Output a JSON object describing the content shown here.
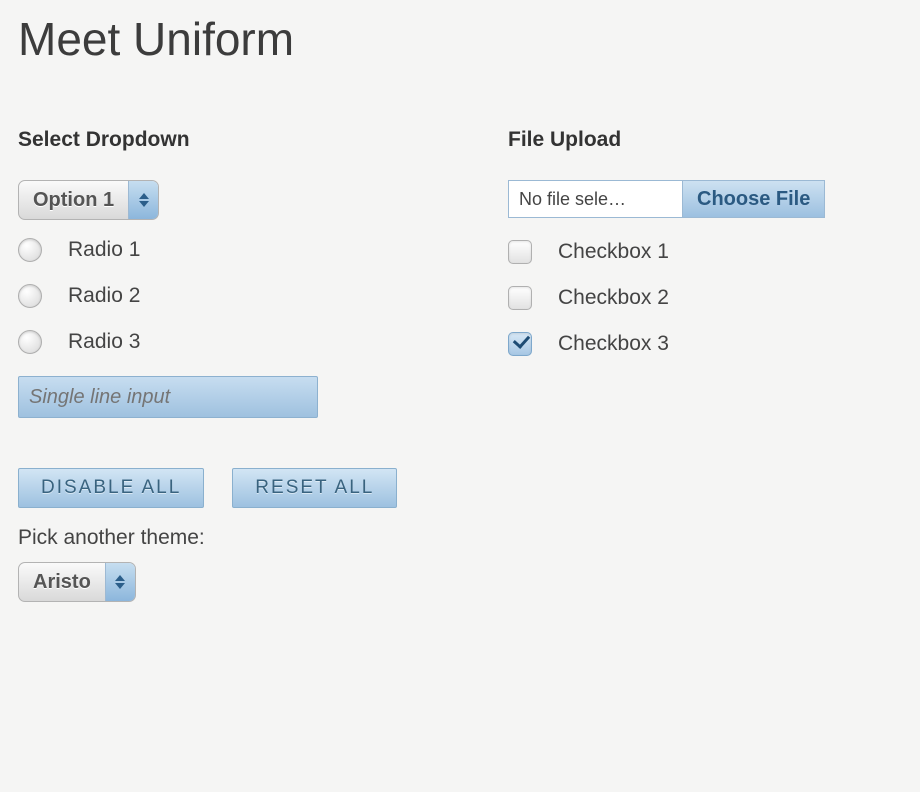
{
  "title": "Meet Uniform",
  "left": {
    "heading": "Select Dropdown",
    "select_value": "Option 1",
    "radios": [
      "Radio 1",
      "Radio 2",
      "Radio 3"
    ],
    "text_placeholder": "Single line input"
  },
  "right": {
    "heading": "File Upload",
    "file_label": "No file sele…",
    "choose_label": "Choose File",
    "checkboxes": [
      {
        "label": "Checkbox 1",
        "checked": false
      },
      {
        "label": "Checkbox 2",
        "checked": false
      },
      {
        "label": "Checkbox 3",
        "checked": true
      }
    ]
  },
  "buttons": {
    "disable": "DISABLE ALL",
    "reset": "RESET ALL"
  },
  "theme": {
    "label": "Pick another theme:",
    "value": "Aristo"
  }
}
